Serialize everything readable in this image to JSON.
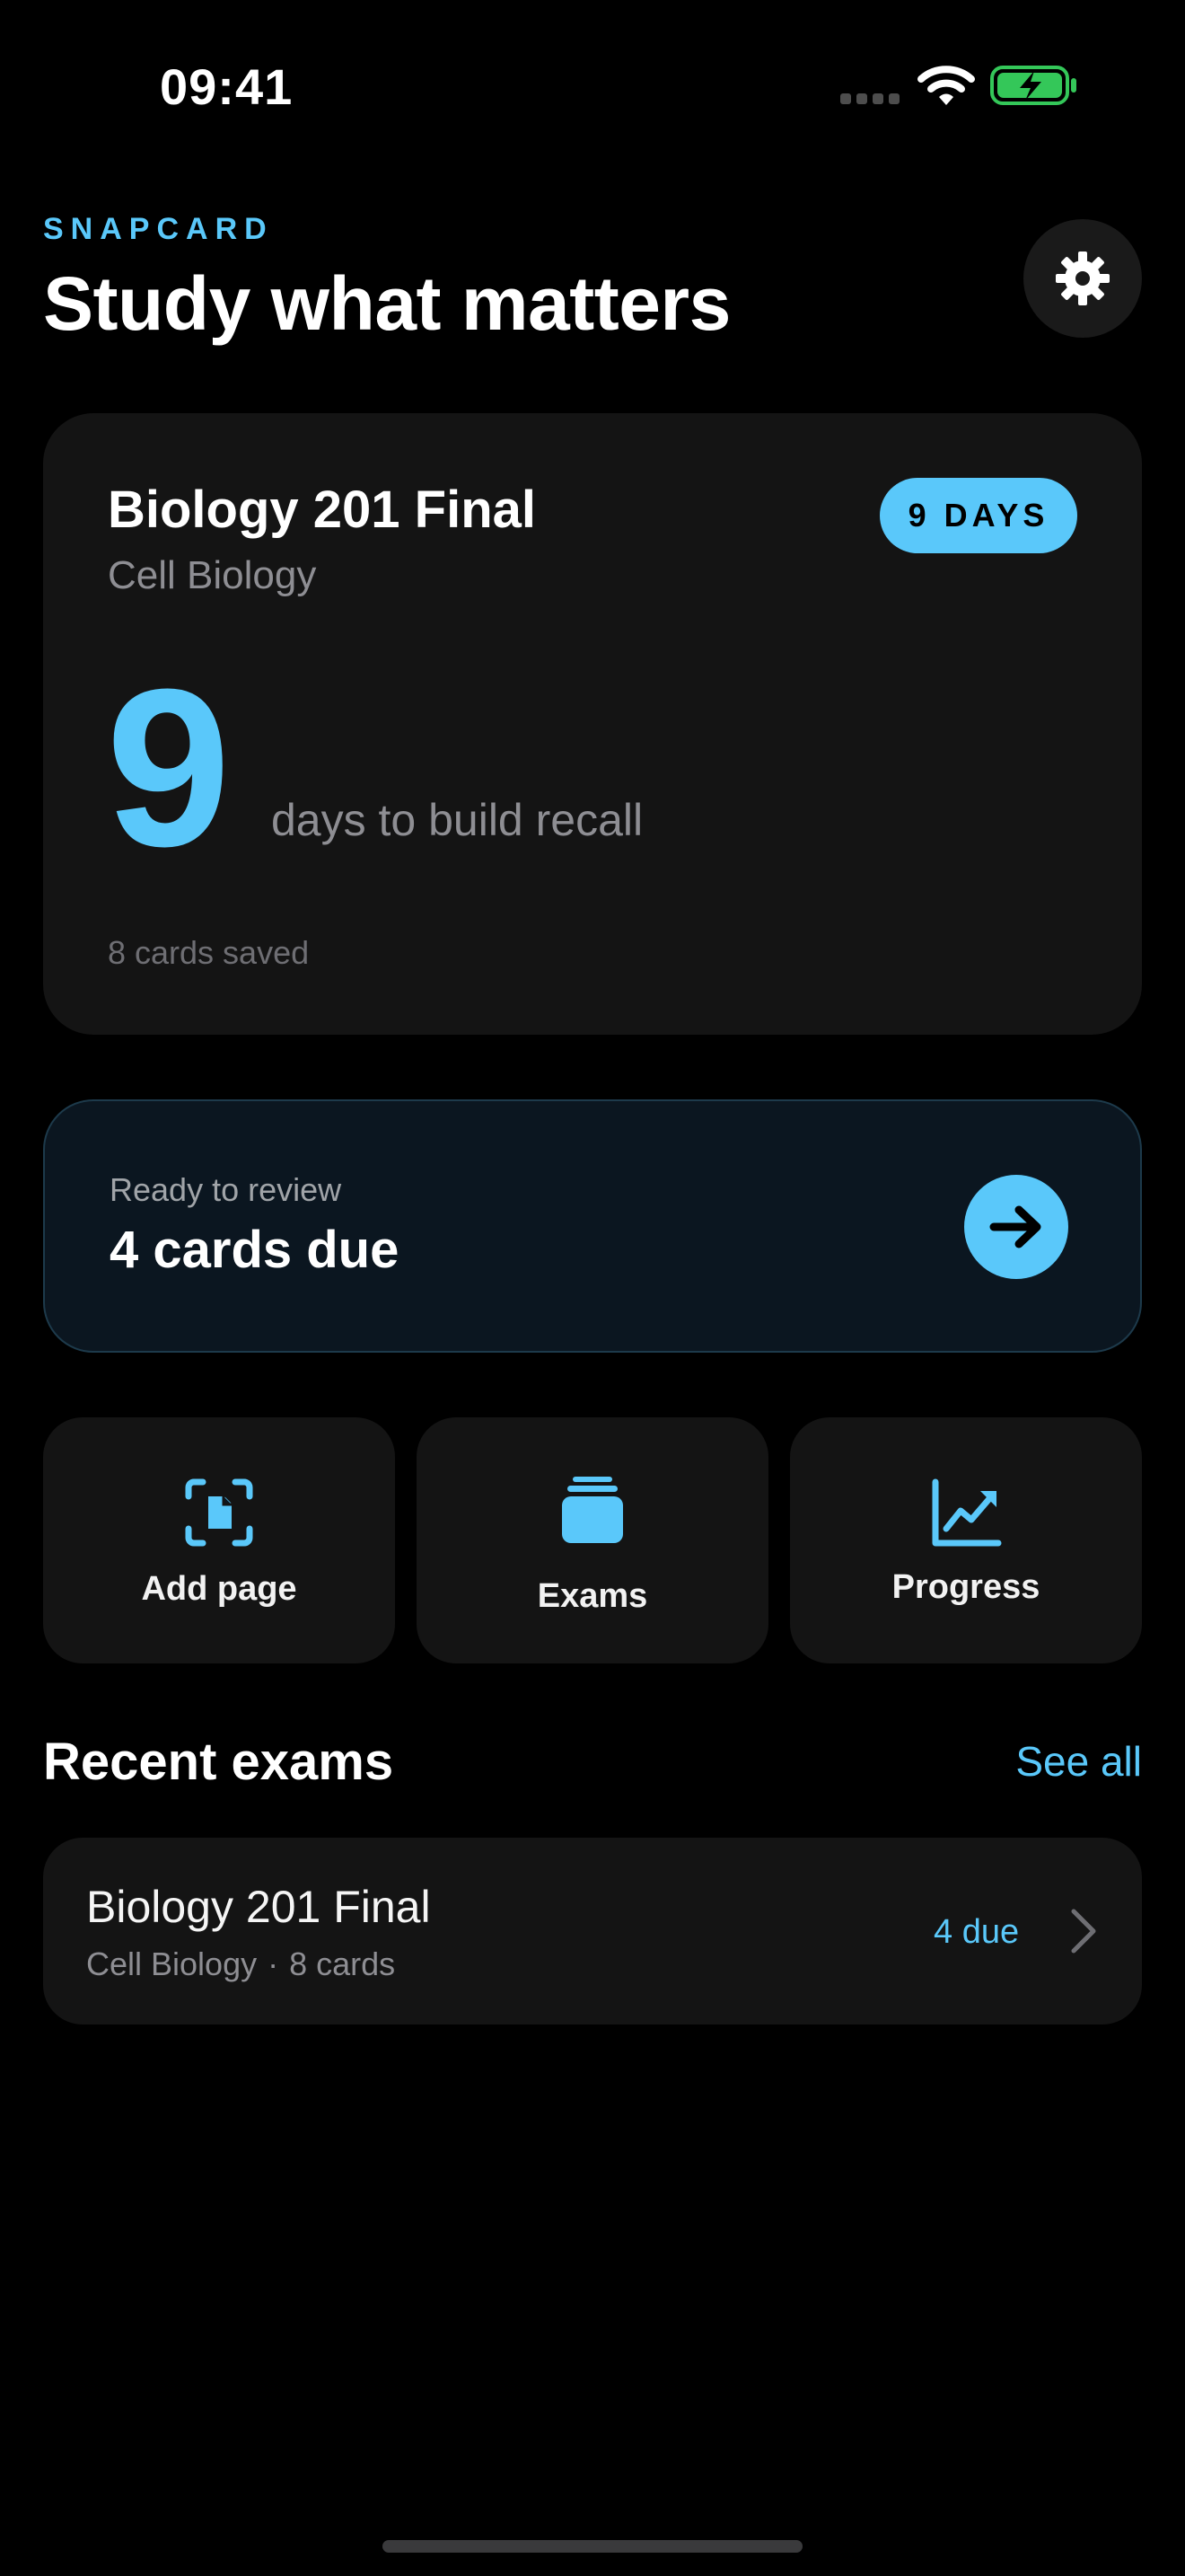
{
  "status_bar": {
    "time": "09:41"
  },
  "header": {
    "brand": "SNAPCARD",
    "title": "Study what matters"
  },
  "exam_card": {
    "title": "Biology 201 Final",
    "subject": "Cell Biology",
    "badge": "9 DAYS",
    "count": "9",
    "count_caption": "days to build recall",
    "saved": "8 cards saved"
  },
  "review": {
    "label": "Ready to review",
    "count": "4 cards due"
  },
  "actions": [
    {
      "label": "Add page",
      "icon": "scan-page-icon"
    },
    {
      "label": "Exams",
      "icon": "stack-icon"
    },
    {
      "label": "Progress",
      "icon": "chart-trend-icon"
    }
  ],
  "recent": {
    "title": "Recent exams",
    "see_all": "See all",
    "items": [
      {
        "title": "Biology 201 Final",
        "subject": "Cell Biology",
        "separator": "·",
        "cards": "8 cards",
        "due": "4 due"
      }
    ]
  },
  "colors": {
    "accent": "#5ac8fa",
    "background": "#000000",
    "card": "#141414",
    "battery": "#34c759"
  }
}
